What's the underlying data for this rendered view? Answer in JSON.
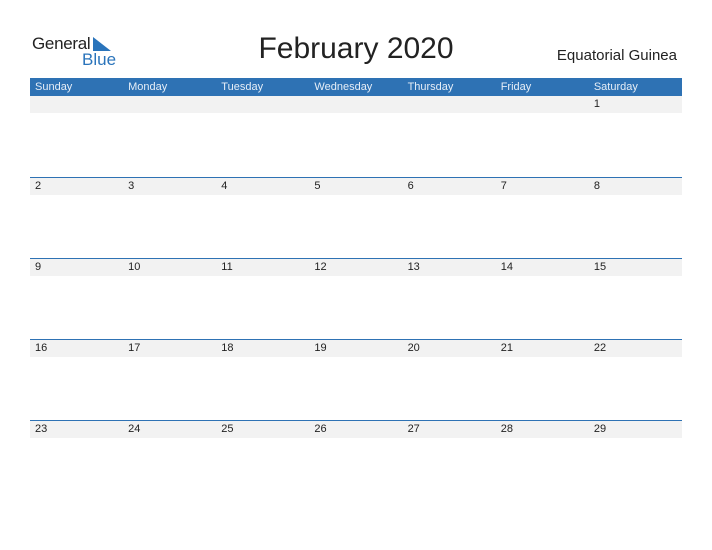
{
  "logo": {
    "word1": "General",
    "word2": "Blue"
  },
  "title": "February 2020",
  "country": "Equatorial Guinea",
  "colors": {
    "accent": "#2e72b4",
    "band": "#f2f2f2"
  },
  "weekdays": [
    "Sunday",
    "Monday",
    "Tuesday",
    "Wednesday",
    "Thursday",
    "Friday",
    "Saturday"
  ],
  "weeks": [
    [
      "",
      "",
      "",
      "",
      "",
      "",
      "1"
    ],
    [
      "2",
      "3",
      "4",
      "5",
      "6",
      "7",
      "8"
    ],
    [
      "9",
      "10",
      "11",
      "12",
      "13",
      "14",
      "15"
    ],
    [
      "16",
      "17",
      "18",
      "19",
      "20",
      "21",
      "22"
    ],
    [
      "23",
      "24",
      "25",
      "26",
      "27",
      "28",
      "29"
    ]
  ]
}
